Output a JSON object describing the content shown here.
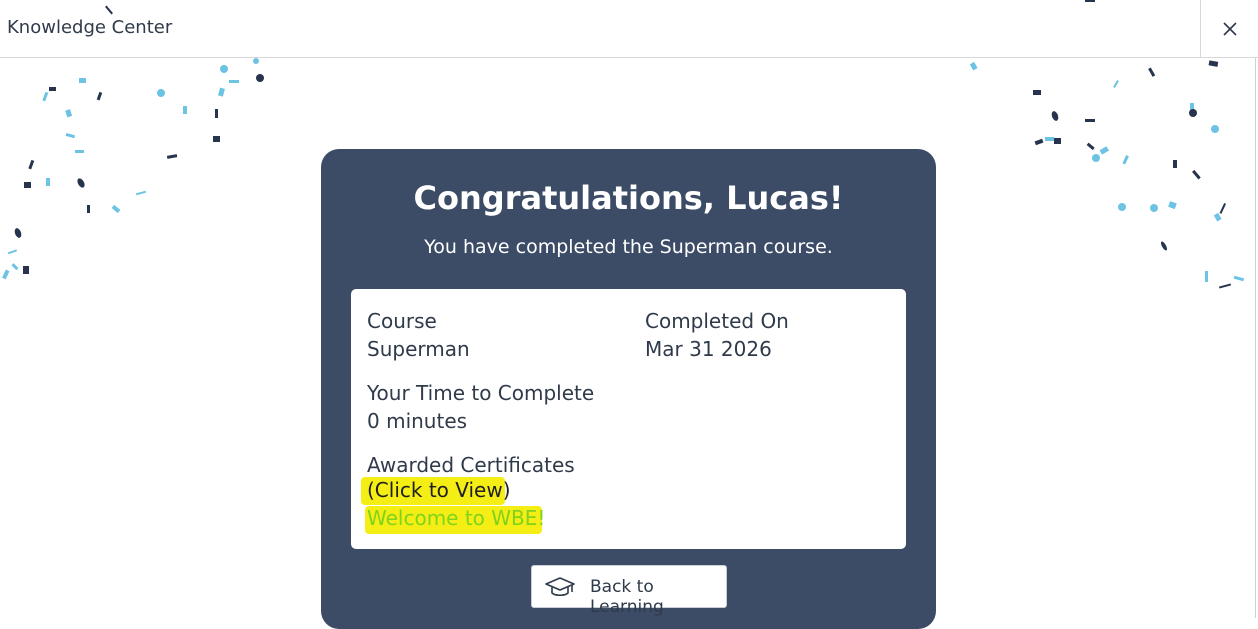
{
  "header": {
    "title": "Knowledge Center",
    "close_icon": "close-icon"
  },
  "card": {
    "title": "Congratulations, Lucas!",
    "subtitle": "You have completed the Superman course.",
    "background_color": "#3c4c66"
  },
  "details": {
    "course_label": "Course",
    "course_value": "Superman",
    "completed_label": "Completed On",
    "completed_value": "Mar 31 2026",
    "time_label": "Your Time to Complete",
    "time_value": "0 minutes",
    "certificates_label": "Awarded Certificates",
    "certificates_link": "(Click to View)",
    "certificate_name": "Welcome to WBE!"
  },
  "actions": {
    "back_label": "Back to Learning",
    "back_icon": "graduation-cap-icon"
  },
  "colors": {
    "highlight": "#f4ee14",
    "certificate_text": "#7fd31c",
    "confetti_light": "#6cc3e3",
    "confetti_dark": "#26344d"
  }
}
